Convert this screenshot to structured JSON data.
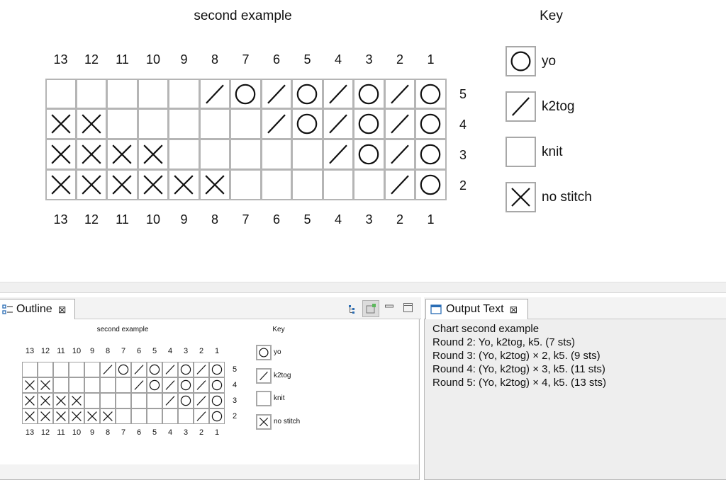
{
  "chart": {
    "title": "second example",
    "key_title": "Key",
    "columns": [
      "13",
      "12",
      "11",
      "10",
      "9",
      "8",
      "7",
      "6",
      "5",
      "4",
      "3",
      "2",
      "1"
    ],
    "rows": [
      {
        "label": "5",
        "cells": [
          "",
          "",
          "",
          "",
          "",
          "k2tog",
          "yo",
          "k2tog",
          "yo",
          "k2tog",
          "yo",
          "k2tog",
          "yo"
        ]
      },
      {
        "label": "4",
        "cells": [
          "x",
          "x",
          "",
          "",
          "",
          "",
          "",
          "k2tog",
          "yo",
          "k2tog",
          "yo",
          "k2tog",
          "yo"
        ]
      },
      {
        "label": "3",
        "cells": [
          "x",
          "x",
          "x",
          "x",
          "",
          "",
          "",
          "",
          "",
          "k2tog",
          "yo",
          "k2tog",
          "yo"
        ]
      },
      {
        "label": "2",
        "cells": [
          "x",
          "x",
          "x",
          "x",
          "x",
          "x",
          "",
          "",
          "",
          "",
          "",
          "k2tog",
          "yo"
        ]
      }
    ],
    "key": [
      {
        "symbol": "yo",
        "label": "yo"
      },
      {
        "symbol": "k2tog",
        "label": "k2tog"
      },
      {
        "symbol": "knit",
        "label": "knit"
      },
      {
        "symbol": "x",
        "label": "no stitch"
      }
    ]
  },
  "outline_view": {
    "tab_label": "Outline",
    "icons": [
      "outline-icon",
      "close-icon",
      "tree-view-icon",
      "sync-icon",
      "minimize-icon",
      "maximize-icon"
    ]
  },
  "output_view": {
    "tab_label": "Output Text",
    "lines": [
      "Chart second example",
      "Round 2: Yo, k2tog, k5. (7 sts)",
      "Round 3: (Yo, k2tog) × 2, k5. (9 sts)",
      "Round 4: (Yo, k2tog) × 3, k5. (11 sts)",
      "Round 5: (Yo, k2tog) × 4, k5. (13 sts)"
    ],
    "icons": [
      "output-icon",
      "close-icon"
    ]
  },
  "colors": {
    "grid_border": "#b5b5b5",
    "panel_bg": "#f2f2f2",
    "tab_bg": "#ffffff"
  }
}
